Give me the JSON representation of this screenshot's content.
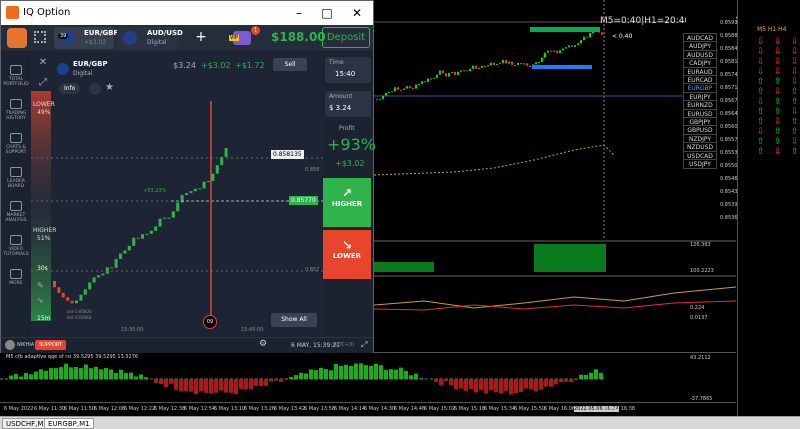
{
  "window": {
    "title": "IQ Option"
  },
  "asset_tabs": [
    {
      "pair": "EUR/GBP",
      "sub": "+$3.02",
      "badge": "39"
    },
    {
      "pair": "AUD/USD",
      "sub": "Digital"
    }
  ],
  "balance": "$188.00",
  "deposit_label": "Deposit",
  "vip_label": "VIP",
  "notif_count": "1",
  "sidebar": [
    {
      "label": "TOTAL PORTFOLIO"
    },
    {
      "label": "TRADING HISTORY"
    },
    {
      "label": "CHATS & SUPPORT"
    },
    {
      "label": "LEADER BOARD"
    },
    {
      "label": "MARKET ANALYSIS"
    },
    {
      "label": "VIDEO TUTORIALS"
    },
    {
      "label": "MORE"
    }
  ],
  "chart": {
    "asset": "EUR/GBP",
    "asset_type": "Digital",
    "info_label": "Info",
    "invest": "$3.24",
    "profit_change": "+$3.02",
    "delta": "+$1.72",
    "sell_label": "Sell",
    "lower_label": "LOWER",
    "lower_pct": "49%",
    "higher_label": "HIGHER",
    "higher_pct": "51%",
    "current_price": "0.858135",
    "strike_price": "0.85770",
    "level1": "0.858",
    "level2": "0.857",
    "trade_pct": "+53.23%",
    "countdown": "09",
    "time_axis_1": "15:30:00",
    "time_axis_2": "15:45:00",
    "timeframe": "15m",
    "zoom": "30s",
    "stats_1": "ask 0.85826",
    "stats_2": "bid 0.85808",
    "show_all_label": "Show All"
  },
  "right_panel": {
    "time_label": "Time",
    "time_value": "15:40",
    "amount_label": "Amount",
    "amount_value": "$ 3.24",
    "profit_label": "Profit",
    "profit_pct": "+93%",
    "profit_value": "+$3.02",
    "higher_btn": "HIGHER",
    "lower_btn": "LOWER"
  },
  "bottom_bar": {
    "user": "NIKHIA",
    "support": "SUPPORT",
    "datetime": "6 MAY, 15:39:21",
    "tz": "(UTC+3)"
  },
  "mt4": {
    "header": "M5=0:40|H1=20:40|H4=200:40",
    "countdown": "< 0.40",
    "price_ticks": [
      "0.85915",
      "0.85880",
      "0.85845",
      "0.85810",
      "0.85745",
      "0.85710",
      "0.85675",
      "0.85640",
      "0.85605",
      "0.85570",
      "0.85535",
      "0.85500",
      "0.85465",
      "0.85430",
      "0.85395",
      "0.85360"
    ],
    "ind1_ticks": [
      "126.383",
      "100.2223"
    ],
    "ind2_ticks": [
      "0.224",
      "0.0137",
      "0.0097"
    ],
    "ind3_title": "M5 cfb adaptive qqe of rsi 39.5295 39.5295 13.5276",
    "ind3_ticks": [
      "43.2112",
      "-37.7865"
    ],
    "symbols": [
      "AUDCAD",
      "AUDJPY",
      "AUDUSD",
      "CADJPY",
      "EURAUD",
      "EURCAD",
      "EURGBP",
      "EURJPY",
      "EURNZD",
      "EURUSD",
      "GBPJPY",
      "GBPUSD",
      "NZDJPY",
      "NZDUSD",
      "USDCAD",
      "USDJPY"
    ],
    "active_symbol": "EURGBP",
    "time_labels": [
      "6 May 2022",
      "6 May 11:30",
      "6 May 11:50",
      "6 May 12:06",
      "6 May 12:22",
      "6 May 12:38",
      "6 May 12:54",
      "6 May 13:10",
      "6 May 13:26",
      "6 May 13:42",
      "6 May 13:58",
      "6 May 14:14",
      "6 May 14:30",
      "6 May 14:46",
      "6 May 15:02",
      "6 May 15:18",
      "6 May 15:34",
      "6 May 15:50",
      "6 May 16:06",
      "2022.05.06 16:24",
      "6 May 16:38"
    ],
    "tabs": [
      "USDCHF,M1",
      "EURGBP,M1"
    ],
    "arrow_header": "M5   H1   H4"
  },
  "colors": {
    "up": "#00e000",
    "down": "#ff2a2a",
    "iq_bg": "#1b2230",
    "higher": "#2fb34b",
    "lower": "#e8452c",
    "accent": "#2fb34b"
  }
}
